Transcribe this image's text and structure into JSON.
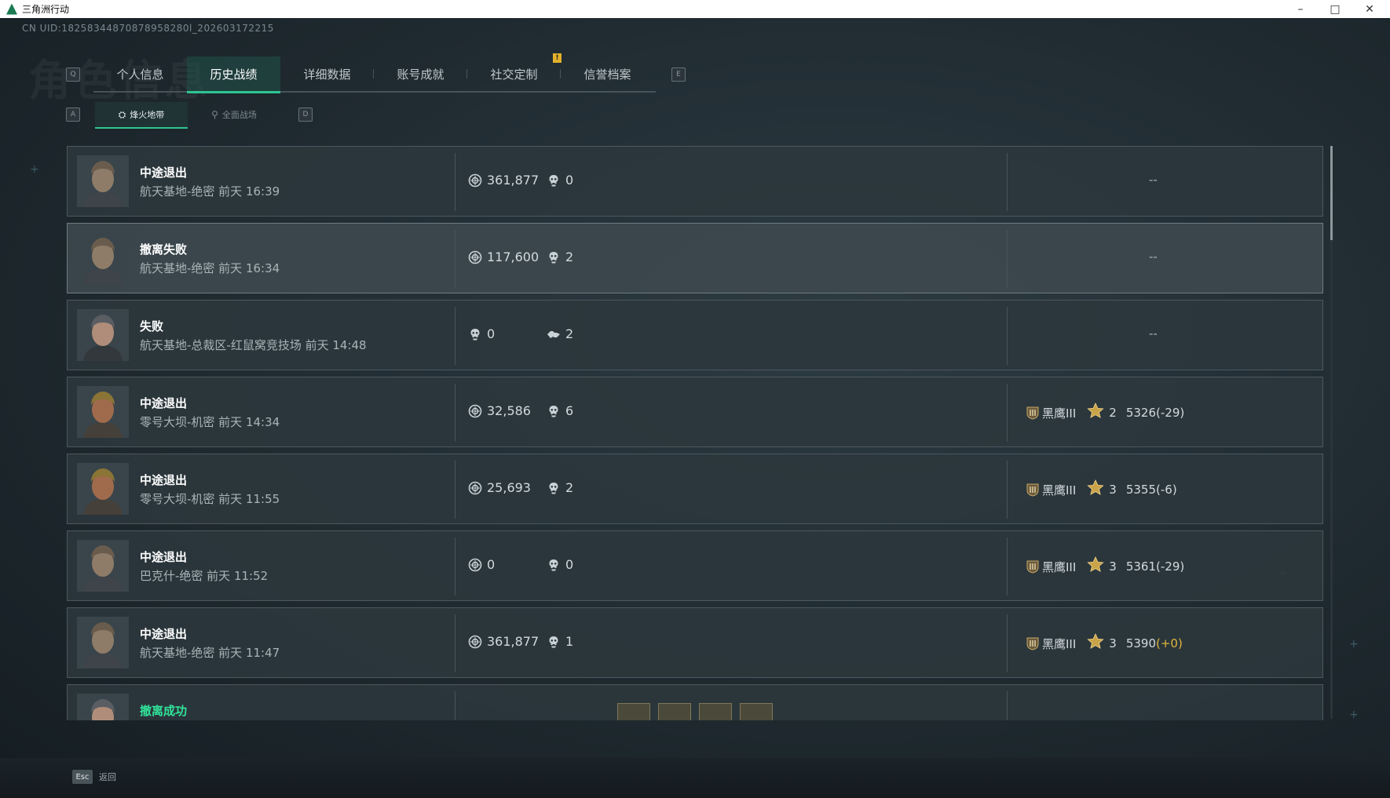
{
  "window": {
    "title": "三角洲行动",
    "minimize": "–",
    "maximize": "□",
    "close": "✕"
  },
  "uid": "CN UID:18258344870878958280l_202603172215",
  "bg_title": "角色信息",
  "tabs": {
    "prev_key": "Q",
    "next_key": "E",
    "items": [
      {
        "label": "个人信息"
      },
      {
        "label": "历史战绩",
        "active": true
      },
      {
        "label": "详细数据"
      },
      {
        "label": "账号成就"
      },
      {
        "label": "社交定制"
      },
      {
        "label": "信誉档案"
      }
    ],
    "notification": "!"
  },
  "subtabs": {
    "prev_key": "A",
    "next_key": "D",
    "items": [
      {
        "label": "烽火地带",
        "icon": "hazard-zone-icon",
        "active": true
      },
      {
        "label": "全面战场",
        "icon": "battlefield-icon"
      }
    ]
  },
  "records": [
    {
      "status": "中途退出",
      "map": "航天基地-绝密 前天 16:39",
      "avatar": "operator-a",
      "stat1_icon": "coin-icon",
      "stat1": "361,877",
      "stat2_icon": "kill-icon",
      "stat2": "0",
      "right": "--"
    },
    {
      "status": "撤离失败",
      "map": "航天基地-绝密 前天 16:34",
      "avatar": "operator-a",
      "stat1_icon": "coin-icon",
      "stat1": "117,600",
      "stat2_icon": "kill-icon",
      "stat2": "2",
      "right": "--",
      "highlight": true
    },
    {
      "status": "失败",
      "map": "航天基地-总裁区-红鼠窝竞技场 前天 14:48",
      "avatar": "operator-b",
      "stat1_icon": "kill-icon",
      "stat1": "0",
      "stat2_icon": "assist-icon",
      "stat2": "2",
      "right": "--"
    },
    {
      "status": "中途退出",
      "map": "零号大坝-机密 前天 14:34",
      "avatar": "operator-c",
      "stat1_icon": "coin-icon",
      "stat1": "32,586",
      "stat2_icon": "kill-icon",
      "stat2": "6",
      "rank": {
        "name": "黑鹰III",
        "stars": "2",
        "score": "5326",
        "delta": "(-29)"
      }
    },
    {
      "status": "中途退出",
      "map": "零号大坝-机密 前天 11:55",
      "avatar": "operator-c",
      "stat1_icon": "coin-icon",
      "stat1": "25,693",
      "stat2_icon": "kill-icon",
      "stat2": "2",
      "rank": {
        "name": "黑鹰III",
        "stars": "3",
        "score": "5355",
        "delta": "(-6)"
      }
    },
    {
      "status": "中途退出",
      "map": "巴克什-绝密 前天 11:52",
      "avatar": "operator-a",
      "stat1_icon": "coin-icon",
      "stat1": "0",
      "stat2_icon": "kill-icon",
      "stat2": "0",
      "rank": {
        "name": "黑鹰III",
        "stars": "3",
        "score": "5361",
        "delta": "(-29)"
      }
    },
    {
      "status": "中途退出",
      "map": "航天基地-绝密 前天 11:47",
      "avatar": "operator-a",
      "stat1_icon": "coin-icon",
      "stat1": "361,877",
      "stat2_icon": "kill-icon",
      "stat2": "1",
      "rank": {
        "name": "黑鹰III",
        "stars": "3",
        "score": "5390",
        "delta": "(+0)",
        "positive": true
      }
    },
    {
      "status": "撤离成功",
      "success": true,
      "avatar": "operator-b"
    }
  ],
  "footer": {
    "esc_key": "Esc",
    "back_label": "返回"
  },
  "colors": {
    "accent": "#2fc592",
    "success": "#31e39a",
    "gold": "#e0b53a"
  }
}
